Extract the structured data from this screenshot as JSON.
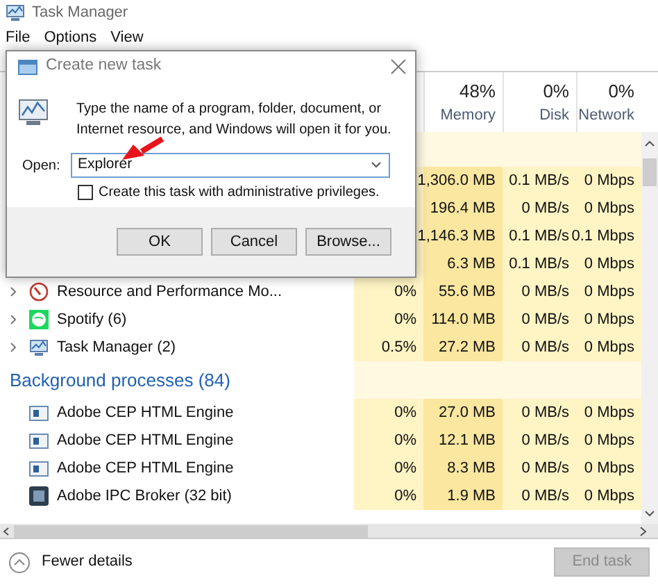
{
  "window": {
    "title": "Task Manager"
  },
  "menu": [
    {
      "label": "File"
    },
    {
      "label": "Options"
    },
    {
      "label": "View"
    }
  ],
  "columns": [
    {
      "percent": "48%",
      "label": "Memory"
    },
    {
      "percent": "0%",
      "label": "Disk"
    },
    {
      "percent": "0%",
      "label": "Network"
    }
  ],
  "rows": [
    {
      "kind": "app",
      "memory": "1,306.0 MB",
      "disk": "0.1 MB/s",
      "network": "0 Mbps"
    },
    {
      "kind": "app",
      "memory": "196.4 MB",
      "disk": "0 MB/s",
      "network": "0 Mbps"
    },
    {
      "kind": "app",
      "memory": "1,146.3 MB",
      "disk": "0.1 MB/s",
      "network": "0.1 Mbps"
    },
    {
      "kind": "app",
      "memory": "6.3 MB",
      "disk": "0.1 MB/s",
      "network": "0 Mbps"
    },
    {
      "kind": "app",
      "expanded": false,
      "name": "Resource and Performance Mo...",
      "cpu": "0%",
      "memory": "55.6 MB",
      "disk": "0 MB/s",
      "network": "0 Mbps"
    },
    {
      "kind": "app",
      "expanded": false,
      "name": "Spotify (6)",
      "cpu": "0%",
      "memory": "114.0 MB",
      "disk": "0 MB/s",
      "network": "0 Mbps"
    },
    {
      "kind": "app",
      "expanded": false,
      "name": "Task Manager (2)",
      "cpu": "0.5%",
      "memory": "27.2 MB",
      "disk": "0 MB/s",
      "network": "0 Mbps"
    },
    {
      "kind": "group",
      "name": "Background processes (84)"
    },
    {
      "kind": "process",
      "name": "Adobe CEP HTML Engine",
      "cpu": "0%",
      "memory": "27.0 MB",
      "disk": "0 MB/s",
      "network": "0 Mbps"
    },
    {
      "kind": "process",
      "name": "Adobe CEP HTML Engine",
      "cpu": "0%",
      "memory": "12.1 MB",
      "disk": "0 MB/s",
      "network": "0 Mbps"
    },
    {
      "kind": "process",
      "name": "Adobe CEP HTML Engine",
      "cpu": "0%",
      "memory": "8.3 MB",
      "disk": "0 MB/s",
      "network": "0 Mbps"
    },
    {
      "kind": "process",
      "name": "Adobe IPC Broker (32 bit)",
      "cpu": "0%",
      "memory": "1.9 MB",
      "disk": "0 MB/s",
      "network": "0 Mbps"
    }
  ],
  "footer": {
    "details_link": "Fewer details",
    "end_button": {
      "label": "End task",
      "disabled": true
    }
  },
  "dialog": {
    "title": "Create new task",
    "message": "Type the name of a program, folder, document, or Internet resource, and Windows will open it for you.",
    "open_label": "Open:",
    "open_value": "Explorer",
    "admin_checkbox": {
      "label": "Create this task with administrative privileges.",
      "checked": false
    },
    "buttons": [
      "OK",
      "Cancel",
      "Browse..."
    ]
  },
  "annotation": {
    "kind": "arrow"
  }
}
